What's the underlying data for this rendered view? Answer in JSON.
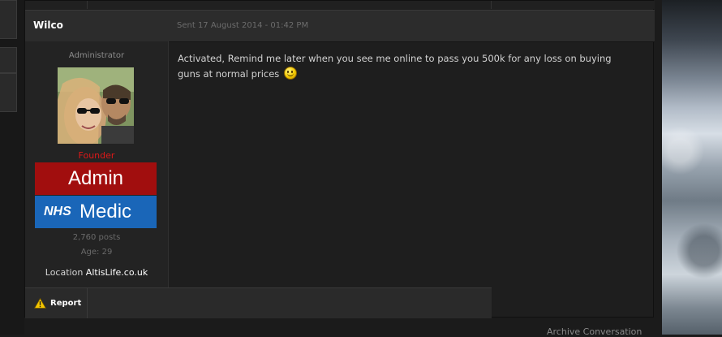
{
  "message": {
    "author": "Wilco",
    "sent": "Sent 17 August 2014 - 01:42 PM",
    "body": "Activated, Remind me later when you see me online to pass you 500k for any loss on buying guns at normal prices",
    "emoticon": "smiley-icon"
  },
  "profile": {
    "role": "Administrator",
    "group_title": "Founder",
    "group_title_color": "#e01818",
    "badges": {
      "admin": {
        "label": "Admin",
        "color": "#a10e0e"
      },
      "medic": {
        "prefix": "NHS",
        "label": "Medic",
        "color": "#1a66b8"
      }
    },
    "posts": "2,760 posts",
    "age": "Age: 29",
    "location_label": "Location",
    "location_value": "AltisLife.co.uk"
  },
  "footer": {
    "report_label": "Report",
    "report_icon": "warning-icon"
  },
  "page": {
    "archive_link": "Archive Conversation"
  }
}
